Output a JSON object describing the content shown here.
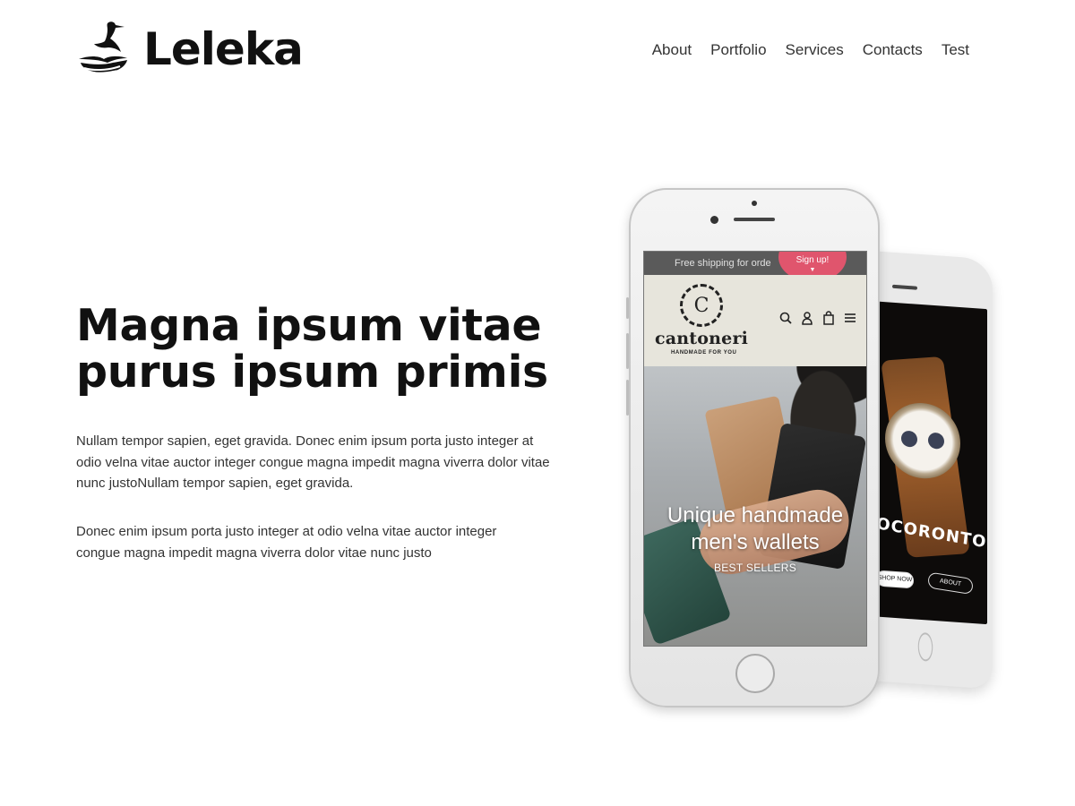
{
  "brand": {
    "name": "Leleka",
    "logo_icon": "stork-in-nest-icon"
  },
  "nav": {
    "items": [
      "About",
      "Portfolio",
      "Services",
      "Contacts",
      "Test"
    ]
  },
  "hero": {
    "title_line1": "Magna ipsum vitae",
    "title_line2": "purus ipsum primis",
    "paragraph1": "Nullam tempor sapien, eget gravida. Donec enim ipsum porta justo integer at odio velna vitae auctor integer congue magna impedit magna viverra dolor vitae nunc justoNullam tempor sapien, eget gravida.",
    "paragraph2": "Donec enim ipsum porta justo integer at odio velna vitae auctor integer congue magna impedit magna viverra dolor vitae nunc justo"
  },
  "mockup": {
    "front": {
      "promo_text": "Free shipping for orde",
      "signup_label": "Sign up!",
      "store_seal_letter": "C",
      "store_name": "cantoneri",
      "store_tagline": "HANDMADE FOR YOU",
      "icons": [
        "search-icon",
        "user-icon",
        "bag-icon",
        "menu-icon"
      ],
      "hero_line1": "Unique handmade",
      "hero_line2": "men's wallets",
      "hero_cta": "BEST SELLERS"
    },
    "back": {
      "brand_text": "OCORONTO",
      "btn_shop": "SHOP NOW",
      "btn_about": "ABOUT"
    }
  },
  "colors": {
    "accent": "#e0556d",
    "text_dark": "#111111",
    "body_text": "#333333"
  }
}
